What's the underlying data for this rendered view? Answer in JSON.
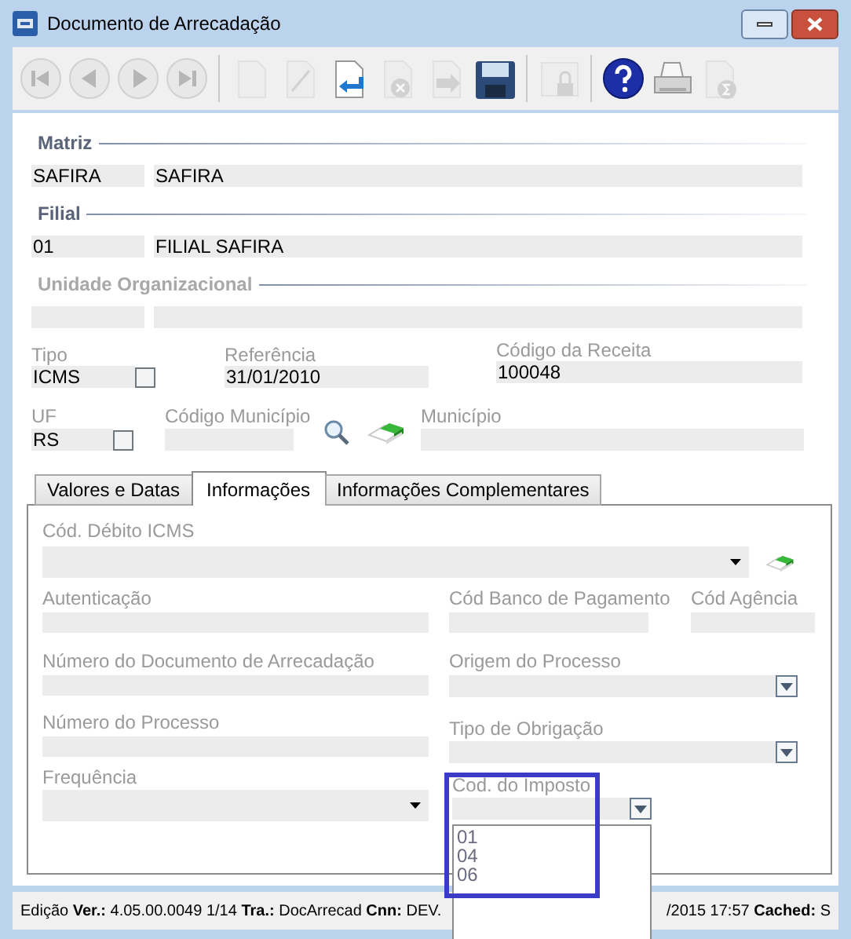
{
  "window": {
    "title": "Documento de Arrecadação"
  },
  "toolbar": [
    {
      "kind": "first",
      "disabled": true
    },
    {
      "kind": "previous",
      "disabled": true
    },
    {
      "kind": "next",
      "disabled": true
    },
    {
      "kind": "last",
      "disabled": true
    },
    {
      "kind": "separator"
    },
    {
      "kind": "new",
      "disabled": true
    },
    {
      "kind": "edit",
      "disabled": true
    },
    {
      "kind": "undo",
      "disabled": false
    },
    {
      "kind": "delete",
      "disabled": true
    },
    {
      "kind": "forward",
      "disabled": true
    },
    {
      "kind": "save",
      "disabled": false
    },
    {
      "kind": "separator"
    },
    {
      "kind": "lock",
      "disabled": true
    },
    {
      "kind": "separator"
    },
    {
      "kind": "help",
      "disabled": false
    },
    {
      "kind": "print",
      "disabled": false
    },
    {
      "kind": "report",
      "disabled": true
    }
  ],
  "sections": [
    {
      "title": "Matriz",
      "disabled": false,
      "code": "SAFIRA",
      "name": "SAFIRA"
    },
    {
      "title": "Filial",
      "disabled": false,
      "code": "01",
      "name": "FILIAL SAFIRA"
    },
    {
      "title": "Unidade Organizacional",
      "disabled": true
    }
  ],
  "tipo": {
    "label": "Tipo",
    "value": "ICMS",
    "checked": false
  },
  "referencia": {
    "label": "Referência",
    "value": "31/01/2010"
  },
  "codigo_receita": {
    "label": "Código da Receita",
    "value": "100048"
  },
  "uf": {
    "label": "UF",
    "value": "RS",
    "checked": false
  },
  "codigo_municipio": {
    "label": "Código Município"
  },
  "municipio": {
    "label": "Município"
  },
  "tabs": [
    {
      "label": "Valores e Datas",
      "selected": false
    },
    {
      "label": "Informações",
      "selected": true
    },
    {
      "label": "Informações Complementares",
      "selected": false
    }
  ],
  "informacoes": {
    "cod_debito_icms": {
      "label": "Cód. Débito ICMS"
    },
    "autenticacao": {
      "label": "Autenticação"
    },
    "cod_banco_pagamento": {
      "label": "Cód Banco de Pagamento"
    },
    "cod_agencia": {
      "label": "Cód Agência"
    },
    "numero_documento": {
      "label": "Número do Documento de Arrecadação"
    },
    "origem_processo": {
      "label": "Origem do Processo"
    },
    "numero_processo": {
      "label": "Número do Processo"
    },
    "tipo_obrigacao": {
      "label": "Tipo de Obrigação"
    },
    "frequencia": {
      "label": "Frequência"
    },
    "cod_imposto": {
      "label": "Cod. do Imposto",
      "options": [
        "01",
        "04",
        "06"
      ]
    }
  },
  "status_bar": {
    "left": "Edição **Ver.:** 4.05.00.0049 1/14 **Tra.:** DocArrecad **Cnn:** DEV.",
    "right": "/2015 17:57 **Cached:** S"
  }
}
